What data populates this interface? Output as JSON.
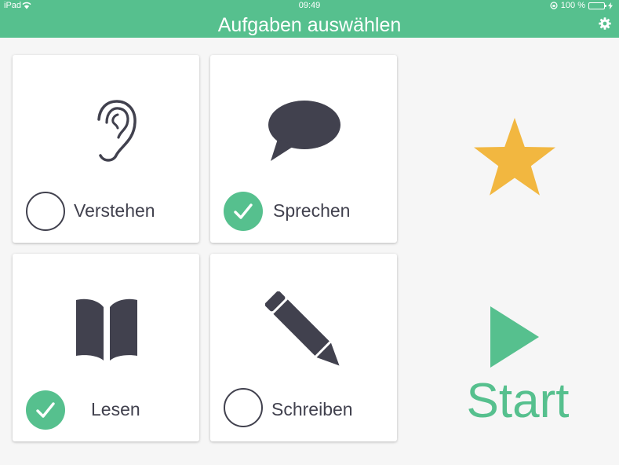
{
  "status": {
    "device": "iPad",
    "time": "09:49",
    "battery": "100 %"
  },
  "header": {
    "title": "Aufgaben auswählen"
  },
  "tasks": [
    {
      "label": "Verstehen",
      "checked": false,
      "icon": "ear-icon"
    },
    {
      "label": "Sprechen",
      "checked": true,
      "icon": "speech-bubble-icon"
    },
    {
      "label": "Lesen",
      "checked": true,
      "icon": "book-icon"
    },
    {
      "label": "Schreiben",
      "checked": false,
      "icon": "pencil-icon"
    }
  ],
  "start": {
    "label": "Start"
  },
  "colors": {
    "accent": "#56c08e",
    "icon": "#41414e",
    "star": "#f2b740",
    "background": "#f6f6f6"
  }
}
